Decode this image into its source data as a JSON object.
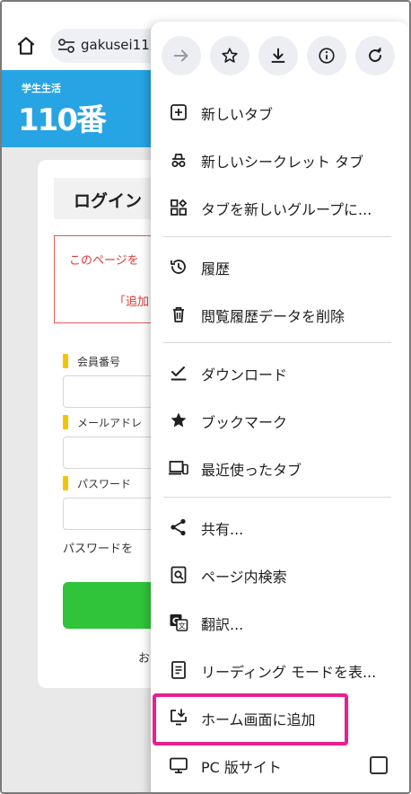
{
  "address_bar": {
    "url": "gakusei11",
    "home_icon": "home-icon",
    "site_settings_icon": "tune-icon"
  },
  "site": {
    "logo_tagline": "学生生活",
    "logo_number": "110番",
    "login_title": "ログイン",
    "alert_line1": "このページを",
    "alert_line2": "「追加",
    "fields": [
      {
        "label": "会員番号"
      },
      {
        "label": "メールアドレ"
      },
      {
        "label": "パスワード"
      }
    ],
    "password_note": "パスワードを",
    "below_button_text": "お"
  },
  "menu": {
    "toolbar": [
      {
        "name": "forward-arrow-icon"
      },
      {
        "name": "star-icon"
      },
      {
        "name": "download-icon"
      },
      {
        "name": "info-icon"
      },
      {
        "name": "reload-icon"
      }
    ],
    "items": [
      {
        "label": "新しいタブ",
        "icon": "new-tab-icon"
      },
      {
        "label": "新しいシークレット タブ",
        "icon": "incognito-icon"
      },
      {
        "label": "タブを新しいグループに...",
        "icon": "tab-group-icon"
      },
      {
        "label": "履歴",
        "icon": "history-icon"
      },
      {
        "label": "閲覧履歴データを削除",
        "icon": "trash-icon"
      },
      {
        "label": "ダウンロード",
        "icon": "download-check-icon"
      },
      {
        "label": "ブックマーク",
        "icon": "star-filled-icon"
      },
      {
        "label": "最近使ったタブ",
        "icon": "devices-icon"
      },
      {
        "label": "共有...",
        "icon": "share-icon"
      },
      {
        "label": "ページ内検索",
        "icon": "find-in-page-icon"
      },
      {
        "label": "翻訳...",
        "icon": "translate-icon"
      },
      {
        "label": "リーディング モードを表...",
        "icon": "reading-mode-icon"
      },
      {
        "label": "ホーム画面に追加",
        "icon": "add-to-home-icon"
      },
      {
        "label": "PC 版サイト",
        "icon": "desktop-icon"
      }
    ],
    "highlight_color": "#e8208e"
  },
  "colors": {
    "header_blue": "#27a4e3",
    "login_green": "#2fc43a",
    "alert_red": "#d83a3a",
    "label_yellow": "#f5c400"
  }
}
